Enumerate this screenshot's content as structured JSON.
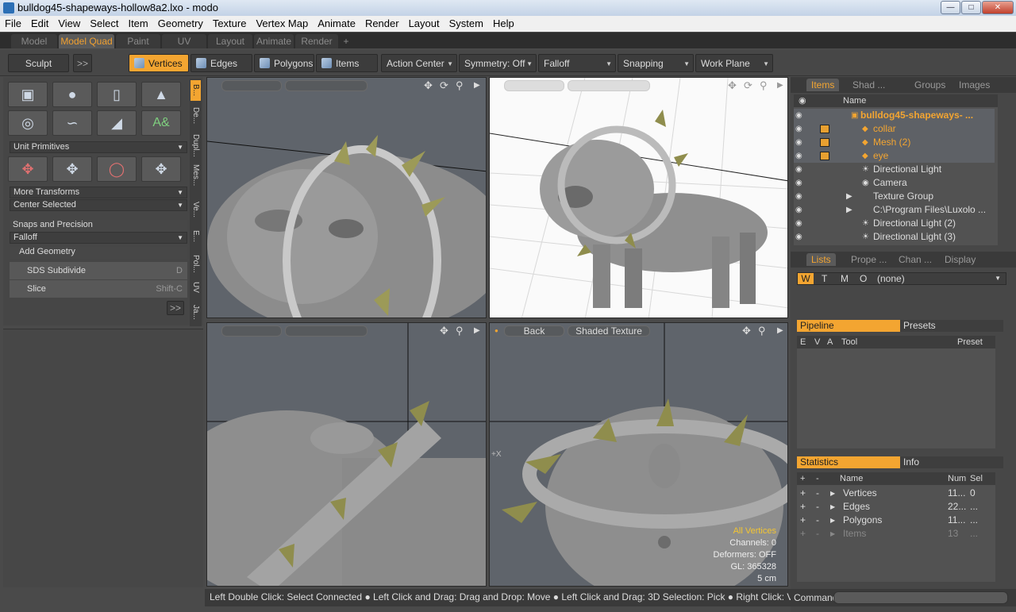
{
  "window": {
    "title": "bulldog45-shapeways-hollow8a2.lxo - modo"
  },
  "menu": [
    "File",
    "Edit",
    "View",
    "Select",
    "Item",
    "Geometry",
    "Texture",
    "Vertex Map",
    "Animate",
    "Render",
    "Layout",
    "System",
    "Help"
  ],
  "layout_tabs": [
    {
      "label": "Model"
    },
    {
      "label": "Model Quad",
      "active": true
    },
    {
      "label": "Paint"
    },
    {
      "label": "UV"
    },
    {
      "label": "Layout"
    },
    {
      "label": "Animate"
    },
    {
      "label": "Render"
    },
    {
      "label": "+"
    }
  ],
  "toolbar": {
    "sculpt": "Sculpt",
    "more": ">>",
    "vertices": "Vertices",
    "edges": "Edges",
    "polygons": "Polygons",
    "items": "Items",
    "action_center": "Action Center",
    "symmetry": "Symmetry: Off",
    "falloff": "Falloff",
    "snapping": "Snapping",
    "work_plane": "Work Plane"
  },
  "left": {
    "unit_primitives": "Unit Primitives",
    "more_transforms": "More Transforms",
    "center_selected": "Center Selected",
    "snaps": "Snaps and Precision",
    "falloff": "Falloff",
    "add_geometry": "Add Geometry",
    "sds": "SDS Subdivide",
    "sds_shortcut": "D",
    "slice": "Slice",
    "slice_shortcut": "Shift-C",
    "more": ">>",
    "vtabs": [
      "B...",
      "De...",
      "Dupl...",
      "Mes...",
      "Ve...",
      "E...",
      "Pol...",
      "UV",
      "Ja..."
    ]
  },
  "viewports": {
    "bottom_right": {
      "view": "Back",
      "shading": "Shaded Texture",
      "label_all": "All Vertices",
      "channels": "Channels: 0",
      "deformers": "Deformers: OFF",
      "gl": "GL: 365328",
      "scale": "5 cm",
      "axis_x": "+X"
    }
  },
  "right": {
    "tabs": [
      "Items",
      "Shad ...",
      "Groups",
      "Images"
    ],
    "name_header": "Name",
    "items": [
      {
        "name": "bulldog45-shapeways- ...",
        "type": "scene",
        "sel": true
      },
      {
        "name": "collar",
        "type": "mesh",
        "sel": true
      },
      {
        "name": "Mesh (2)",
        "type": "mesh",
        "sel": true
      },
      {
        "name": "eye",
        "type": "mesh",
        "sel": true
      },
      {
        "name": "Directional Light",
        "type": "light"
      },
      {
        "name": "Camera",
        "type": "camera"
      },
      {
        "name": "Texture Group",
        "type": "group"
      },
      {
        "name": "C:\\Program Files\\Luxolo ...",
        "type": "group"
      },
      {
        "name": "Directional Light (2)",
        "type": "light"
      },
      {
        "name": "Directional Light (3)",
        "type": "light"
      }
    ],
    "tabs2": [
      "Lists",
      "Prope ...",
      "Chan ...",
      "Display"
    ],
    "wtmo": [
      "W",
      "T",
      "M",
      "O"
    ],
    "none_label": "(none)",
    "pipeline": "Pipeline",
    "presets": "Presets",
    "pipe_cols": [
      "E",
      "V",
      "A",
      "Tool",
      "Preset"
    ],
    "statistics": "Statistics",
    "info": "Info",
    "stat_cols": [
      "+",
      "-",
      "Name",
      "Num",
      "Sel"
    ],
    "stats": [
      {
        "name": "Vertices",
        "num": "11...",
        "sel": "0"
      },
      {
        "name": "Edges",
        "num": "22...",
        "sel": "..."
      },
      {
        "name": "Polygons",
        "num": "11...",
        "sel": "..."
      },
      {
        "name": "Items",
        "num": "13",
        "sel": "...",
        "dim": true
      }
    ]
  },
  "status": "Left Double Click: Select Connected ● Left Click and Drag: Drag and Drop: Move ● Left Click and Drag: 3D Selection: Pick ● Right Click: Viewport C ...",
  "command_label": "Command"
}
